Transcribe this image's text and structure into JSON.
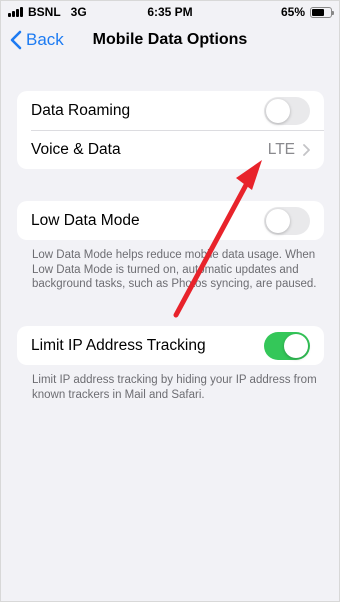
{
  "status_bar": {
    "carrier": "BSNL",
    "network": "3G",
    "time": "6:35 PM",
    "battery_percent": "65%",
    "battery_level": 0.65
  },
  "nav": {
    "back_label": "Back",
    "title": "Mobile Data Options"
  },
  "group1": {
    "data_roaming": {
      "label": "Data Roaming",
      "enabled": false
    },
    "voice_data": {
      "label": "Voice & Data",
      "value": "LTE"
    }
  },
  "group2": {
    "low_data_mode": {
      "label": "Low Data Mode",
      "enabled": false
    },
    "footnote": "Low Data Mode helps reduce mobile data usage. When Low Data Mode is turned on, automatic updates and background tasks, such as Photos syncing, are paused."
  },
  "group3": {
    "limit_ip": {
      "label": "Limit IP Address Tracking",
      "enabled": true
    },
    "footnote": "Limit IP address tracking by hiding your IP address from known trackers in Mail and Safari."
  },
  "colors": {
    "accent": "#1d7bf2",
    "toggle_on": "#34c759",
    "annotation_arrow": "#e8232b"
  }
}
